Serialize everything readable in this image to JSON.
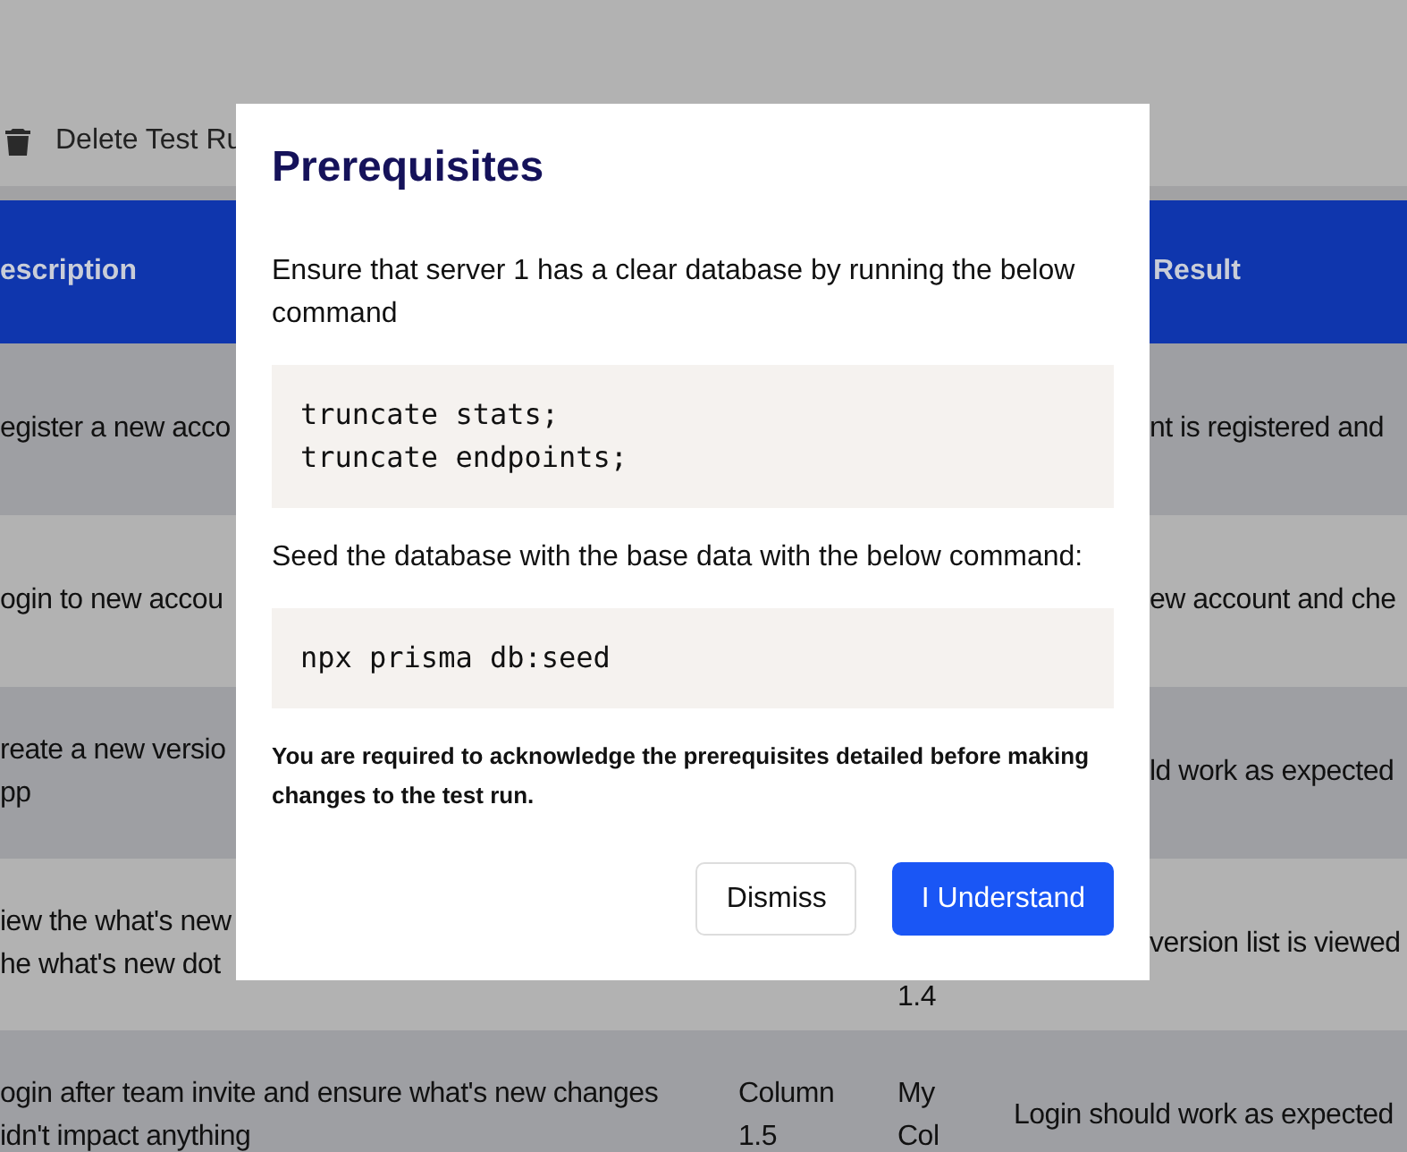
{
  "toolbar": {
    "delete_button": "Delete Test Ru"
  },
  "table": {
    "columns": [
      {
        "label": "escription"
      },
      {
        "label": "Result"
      }
    ],
    "rows": [
      {
        "description": [
          "egister a new acco"
        ],
        "result": "nt is registered and"
      },
      {
        "description": [
          "ogin to new accou"
        ],
        "result": "ew account and che"
      },
      {
        "description": [
          "reate a new versio",
          "pp"
        ],
        "result": "ld work as expected"
      },
      {
        "description": [
          "iew the what's new",
          "he what's new dot"
        ],
        "column_3": [
          "1.4"
        ],
        "result": "version list is viewed"
      },
      {
        "description": [
          "ogin after team invite and ensure what's new changes",
          "idn't impact anything"
        ],
        "column_2": [
          "Column",
          "1.5"
        ],
        "column_3": [
          "My",
          "Col"
        ],
        "result": "Login should work as expected"
      }
    ]
  },
  "dialog": {
    "title": "Prerequisites",
    "body": [
      {
        "kind": "text",
        "text": "Ensure that server 1 has a clear database by running the below command"
      },
      {
        "kind": "code",
        "lines": [
          "truncate stats;",
          "truncate endpoints;"
        ]
      },
      {
        "kind": "text",
        "text": "Seed the database with the base data with the below command:"
      },
      {
        "kind": "code",
        "lines": [
          "npx prisma db:seed"
        ]
      },
      {
        "kind": "note",
        "text": "You are required to acknowledge the prerequisites detailed before making changes to the test run."
      }
    ],
    "buttons": [
      {
        "kind": "secondary",
        "label": "Dismiss"
      },
      {
        "kind": "primary",
        "label": "I Understand"
      }
    ]
  }
}
